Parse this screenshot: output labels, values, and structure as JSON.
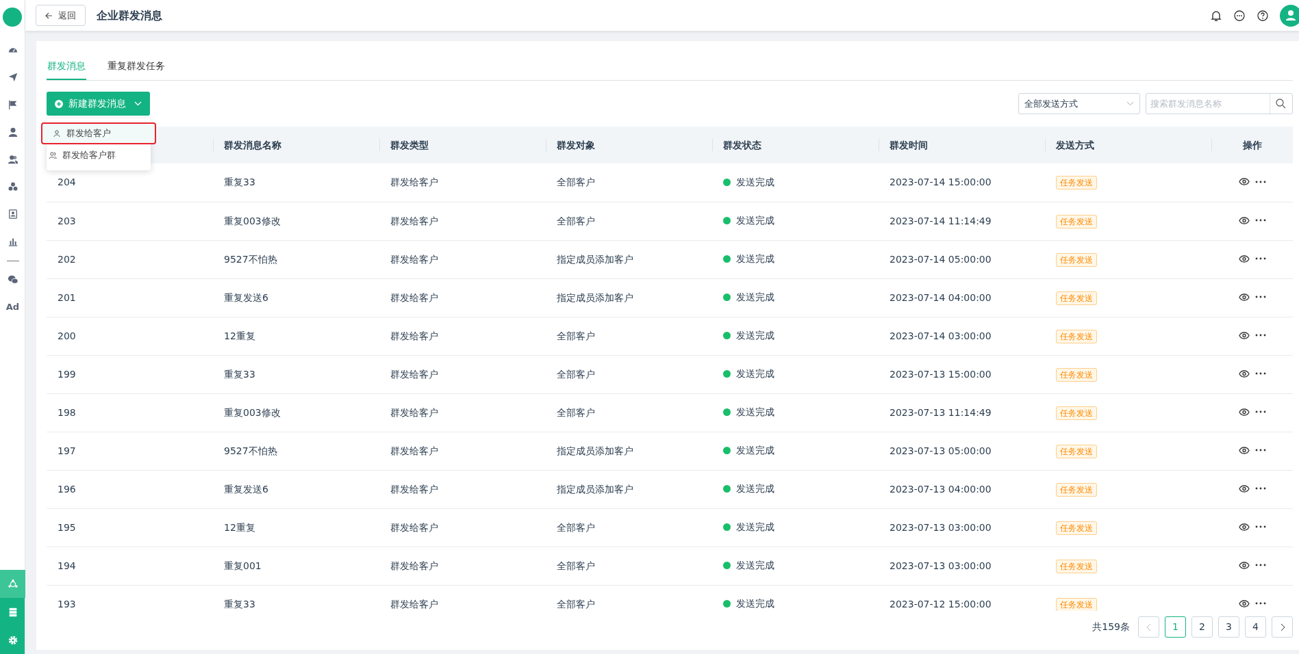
{
  "header": {
    "back_button": "返回",
    "title": "企业群发消息"
  },
  "sidebar": {
    "items": [
      {
        "selected": false
      },
      {
        "selected": false
      },
      {
        "selected": false
      },
      {
        "selected": false
      },
      {
        "selected": false
      },
      {
        "selected": false
      },
      {
        "selected": false
      },
      {
        "selected": false
      },
      {
        "selected": false
      },
      {
        "label": "Ad",
        "selected": false
      }
    ],
    "bottom_items": [
      {
        "selected": true
      },
      {
        "selected": false
      },
      {
        "selected": false
      }
    ]
  },
  "tabs": [
    {
      "label": "群发消息",
      "selected": true
    },
    {
      "label": "重复群发任务",
      "selected": false
    }
  ],
  "new_button": {
    "label": "新建群发消息"
  },
  "dropdown_menu": [
    {
      "label": "群发给客户",
      "selected": true
    },
    {
      "label": "群发给客户群",
      "selected": false
    }
  ],
  "filter": {
    "value": "全部发送方式"
  },
  "search": {
    "placeholder": "搜索群发消息名称"
  },
  "table": {
    "columns": [
      "群发消息名称",
      "群发类型",
      "群发对象",
      "群发状态",
      "群发时间",
      "发送方式",
      "操作"
    ],
    "rows": [
      {
        "id": "204",
        "name": "重复33",
        "type": "群发给客户",
        "target": "全部客户",
        "status": "发送完成",
        "color": "#19be6b",
        "time": "2023-07-14 15:00:00",
        "method": "任务发送"
      },
      {
        "id": "203",
        "name": "重复003修改",
        "type": "群发给客户",
        "target": "全部客户",
        "status": "发送完成",
        "color": "#19be6b",
        "time": "2023-07-14 11:14:49",
        "method": "任务发送"
      },
      {
        "id": "202",
        "name": "9527不怕热",
        "type": "群发给客户",
        "target": "指定成员添加客户",
        "status": "发送完成",
        "color": "#19be6b",
        "time": "2023-07-14 05:00:00",
        "method": "任务发送"
      },
      {
        "id": "201",
        "name": "重复发送6",
        "type": "群发给客户",
        "target": "指定成员添加客户",
        "status": "发送完成",
        "color": "#19be6b",
        "time": "2023-07-14 04:00:00",
        "method": "任务发送"
      },
      {
        "id": "200",
        "name": "12重复",
        "type": "群发给客户",
        "target": "全部客户",
        "status": "发送完成",
        "color": "#19be6b",
        "time": "2023-07-14 03:00:00",
        "method": "任务发送"
      },
      {
        "id": "199",
        "name": "重复33",
        "type": "群发给客户",
        "target": "全部客户",
        "status": "发送完成",
        "color": "#19be6b",
        "time": "2023-07-13 15:00:00",
        "method": "任务发送"
      },
      {
        "id": "198",
        "name": "重复003修改",
        "type": "群发给客户",
        "target": "全部客户",
        "status": "发送完成",
        "color": "#19be6b",
        "time": "2023-07-13 11:14:49",
        "method": "任务发送"
      },
      {
        "id": "197",
        "name": "9527不怕热",
        "type": "群发给客户",
        "target": "指定成员添加客户",
        "status": "发送完成",
        "color": "#19be6b",
        "time": "2023-07-13 05:00:00",
        "method": "任务发送"
      },
      {
        "id": "196",
        "name": "重复发送6",
        "type": "群发给客户",
        "target": "指定成员添加客户",
        "status": "发送完成",
        "color": "#19be6b",
        "time": "2023-07-13 04:00:00",
        "method": "任务发送"
      },
      {
        "id": "195",
        "name": "12重复",
        "type": "群发给客户",
        "target": "全部客户",
        "status": "发送完成",
        "color": "#19be6b",
        "time": "2023-07-13 03:00:00",
        "method": "任务发送"
      },
      {
        "id": "194",
        "name": "重复001",
        "type": "群发给客户",
        "target": "全部客户",
        "status": "发送完成",
        "color": "#19be6b",
        "time": "2023-07-13 03:00:00",
        "method": "任务发送"
      },
      {
        "id": "193",
        "name": "重复33",
        "type": "群发给客户",
        "target": "全部客户",
        "status": "发送完成",
        "color": "#19be6b",
        "time": "2023-07-12 15:00:00",
        "method": "任务发送"
      }
    ]
  },
  "pagination": {
    "total": "共159条",
    "pages": [
      {
        "label": "1",
        "selected": true
      },
      {
        "label": "2",
        "selected": false
      },
      {
        "label": "3",
        "selected": false
      },
      {
        "label": "4",
        "selected": false
      }
    ]
  }
}
